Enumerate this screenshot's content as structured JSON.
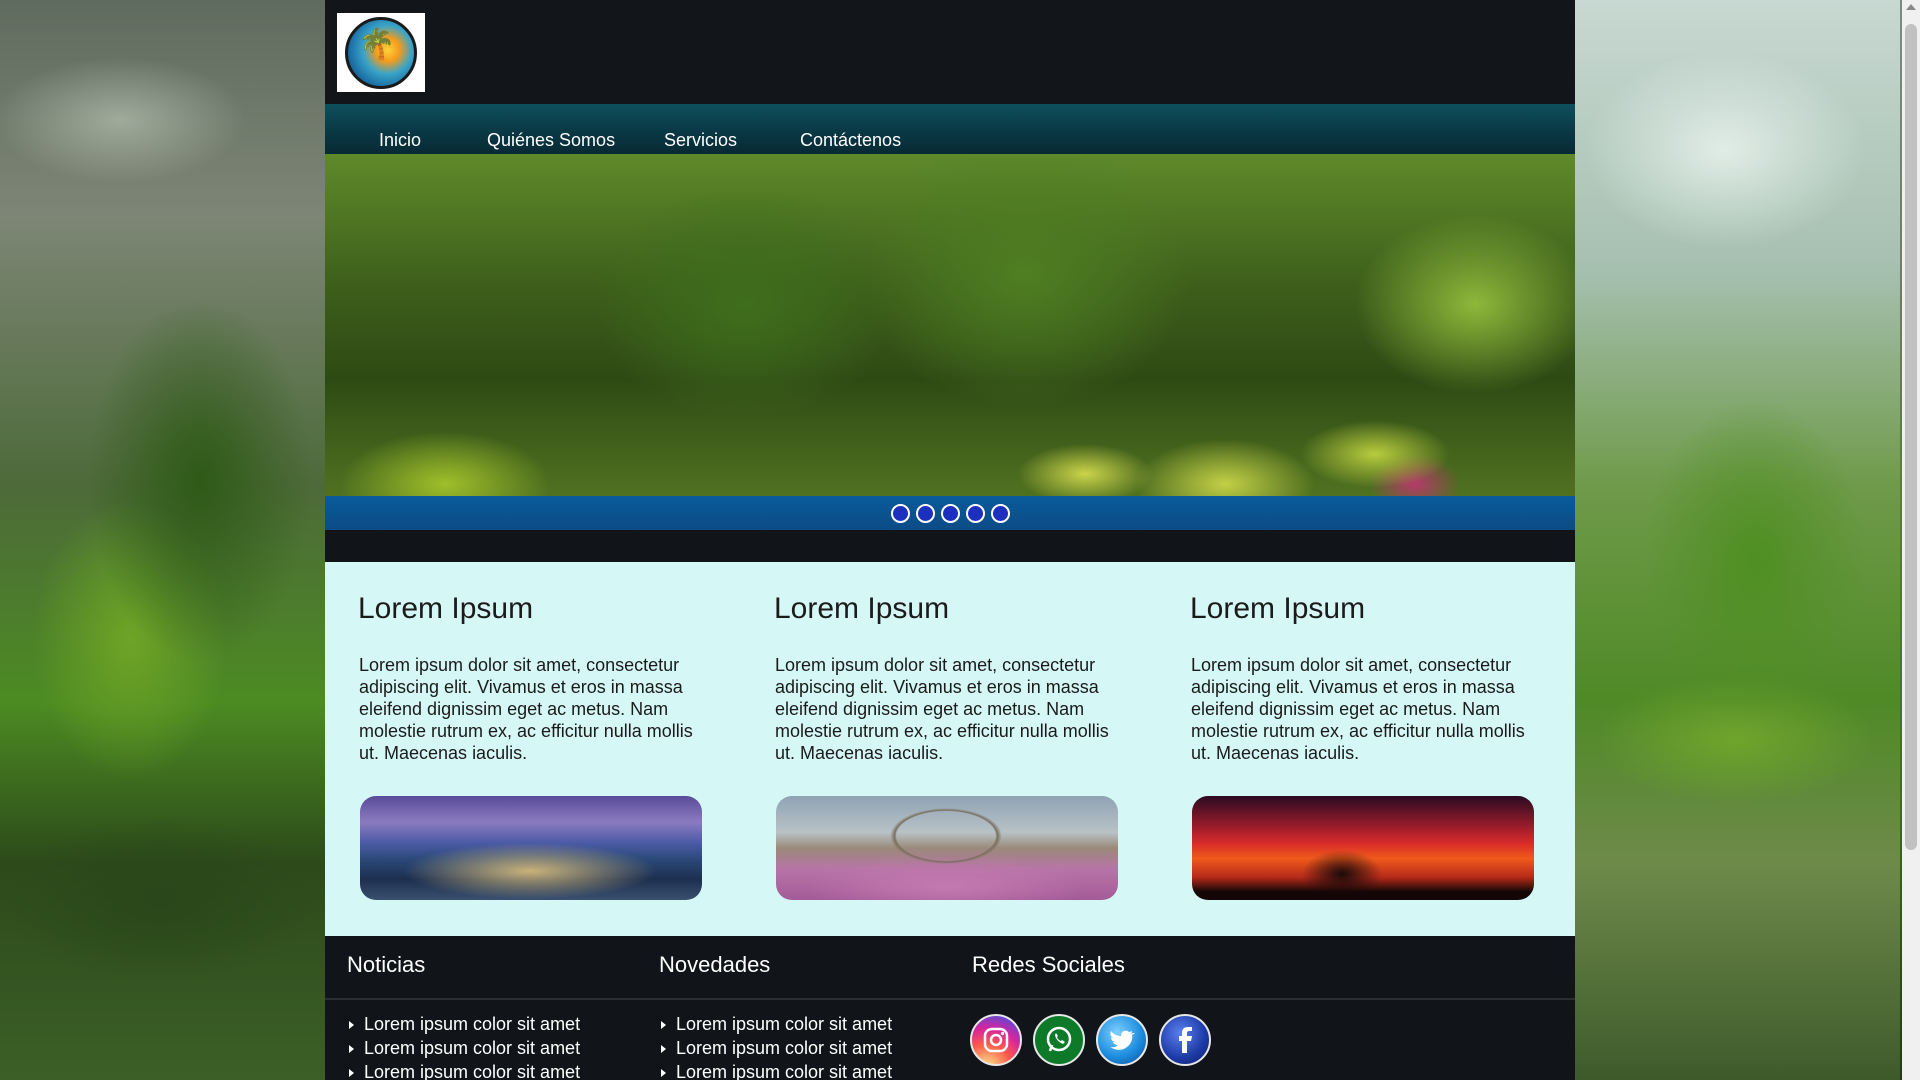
{
  "nav": {
    "items": [
      {
        "label": "Inicio"
      },
      {
        "label": "Quiénes Somos"
      },
      {
        "label": "Servicios"
      },
      {
        "label": "Contáctenos"
      }
    ]
  },
  "slider": {
    "dots": 5
  },
  "features": [
    {
      "title": "Lorem Ipsum",
      "text": "Lorem ipsum dolor sit amet, consectetur adipiscing elit. Vivamus et eros in massa eleifend dignissim eget ac metus. Nam molestie rutrum ex, ac efficitur nulla mollis ut. Maecenas iaculis."
    },
    {
      "title": "Lorem Ipsum",
      "text": "Lorem ipsum dolor sit amet, consectetur adipiscing elit. Vivamus et eros in massa eleifend dignissim eget ac metus. Nam molestie rutrum ex, ac efficitur nulla mollis ut. Maecenas iaculis."
    },
    {
      "title": "Lorem Ipsum",
      "text": "Lorem ipsum dolor sit amet, consectetur adipiscing elit. Vivamus et eros in massa eleifend dignissim eget ac metus. Nam molestie rutrum ex, ac efficitur nulla mollis ut. Maecenas iaculis."
    }
  ],
  "footer": {
    "noticias": {
      "title": "Noticias",
      "items": [
        "Lorem ipsum color sit amet",
        "Lorem ipsum color sit amet",
        "Lorem ipsum color sit amet"
      ]
    },
    "novedades": {
      "title": "Novedades",
      "items": [
        "Lorem ipsum color sit amet",
        "Lorem ipsum color sit amet",
        "Lorem ipsum color sit amet"
      ]
    },
    "redes": {
      "title": "Redes Sociales",
      "icons": [
        "instagram-icon",
        "whatsapp-icon",
        "twitter-icon",
        "facebook-icon"
      ]
    }
  }
}
